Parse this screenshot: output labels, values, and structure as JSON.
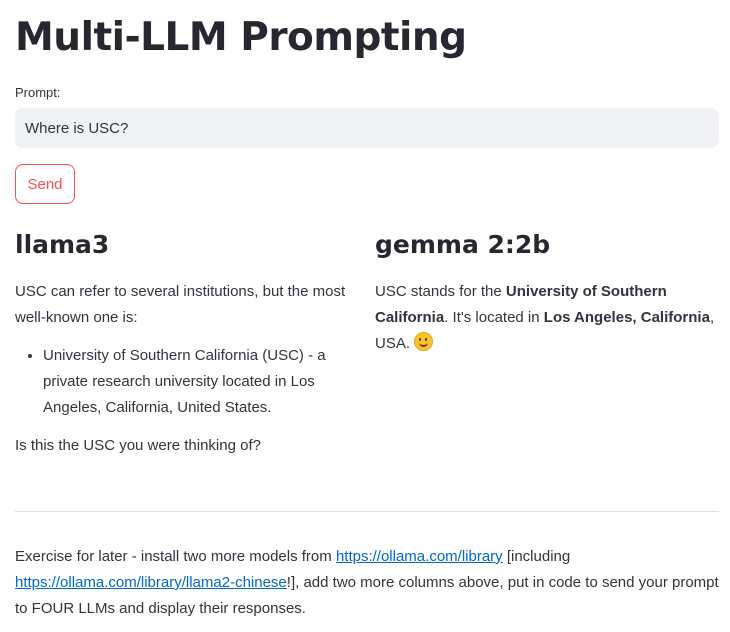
{
  "page": {
    "title": "Multi-LLM Prompting"
  },
  "prompt": {
    "label": "Prompt:",
    "value": "Where is USC?"
  },
  "send_label": "Send",
  "columns": {
    "left": {
      "heading": "llama3",
      "intro": "USC can refer to several institutions, but the most well-known one is:",
      "bullet": "University of Southern California (USC) - a private research university located in Los Angeles, California, United States.",
      "outro": "Is this the USC you were thinking of?"
    },
    "right": {
      "heading": "gemma 2:2b",
      "t1": "USC stands for the ",
      "b1": "University of Southern California",
      "t2": ". It's located in ",
      "b2": "Los Angeles, California",
      "t3": ", USA. ",
      "emoji_icon": "smiling-face-emoji"
    }
  },
  "footer": {
    "t1": "Exercise for later - install two more models from ",
    "link1": "https://ollama.com/library",
    "t2": " [including ",
    "link2": "https://ollama.com/library/llama2-chinese",
    "t3": "!], add two more columns above, put in code to send your prompt to FOUR LLMs and display their responses."
  },
  "colors": {
    "accent": "#ff4b4b",
    "link": "#0068c9",
    "input_bg": "#f0f2f6"
  }
}
